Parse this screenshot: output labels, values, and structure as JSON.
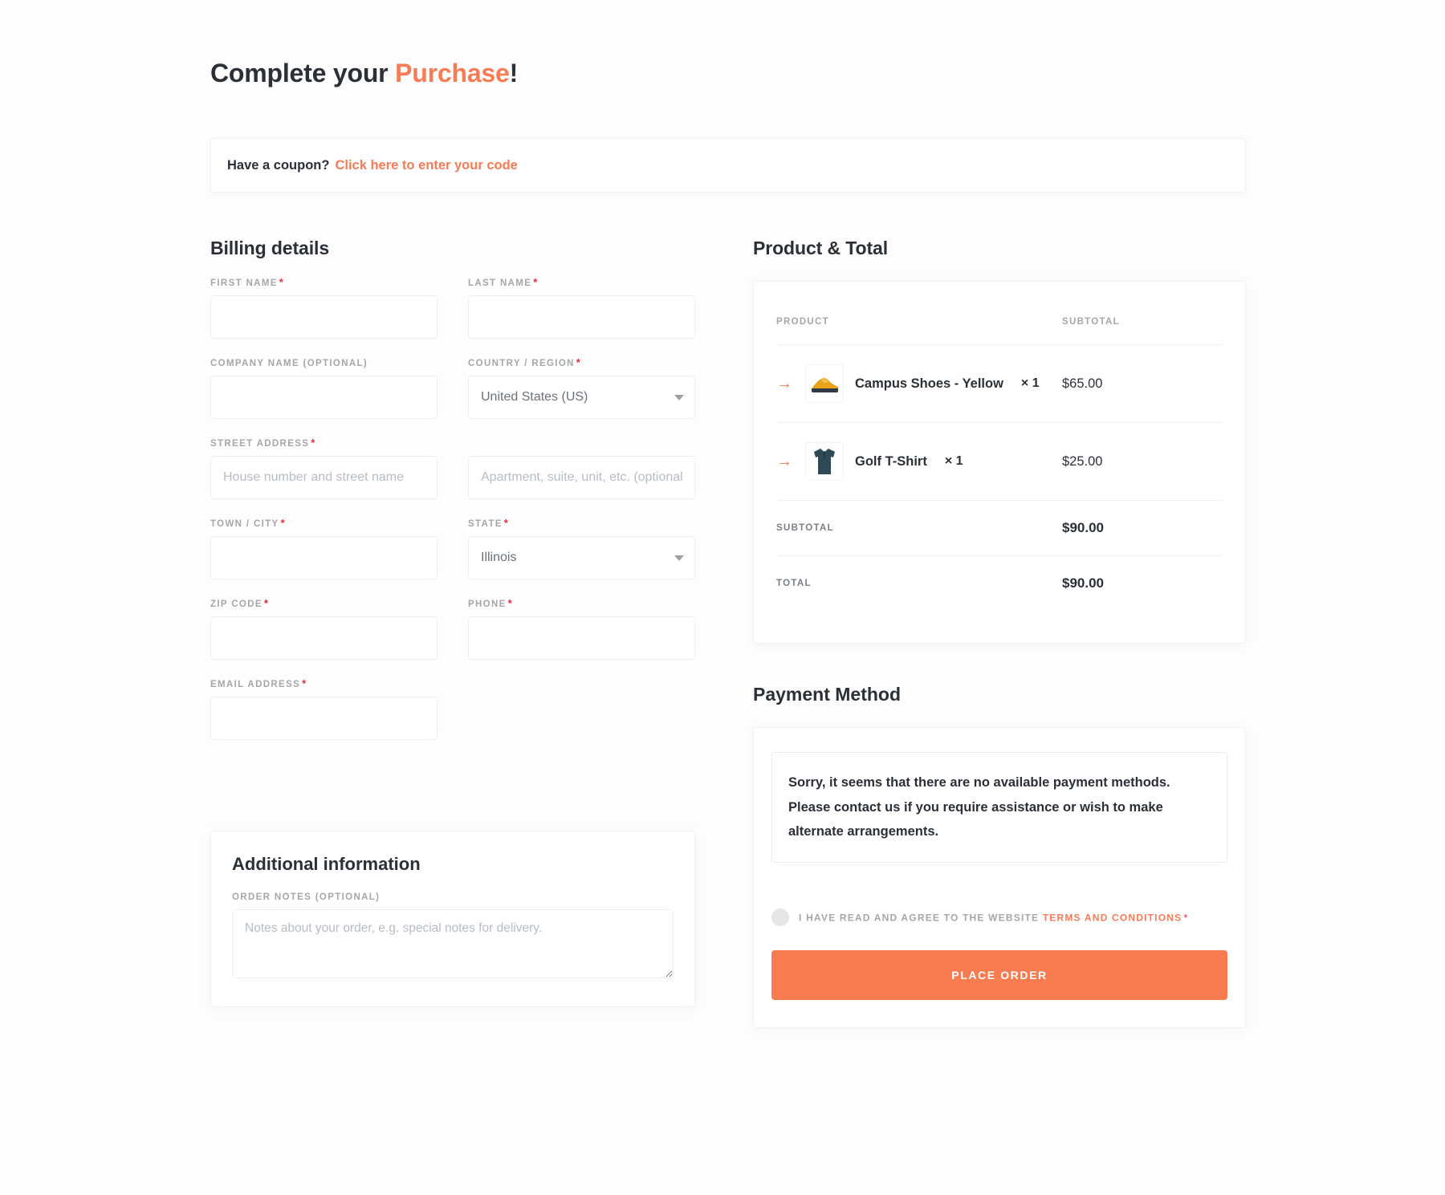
{
  "title": {
    "lead": "Complete your ",
    "accent": "Purchase",
    "trail": "!"
  },
  "coupon": {
    "prompt": "Have a coupon?",
    "link": "Click here to enter your code"
  },
  "billing": {
    "heading": "Billing details",
    "fields": {
      "first_name": {
        "label": "FIRST NAME",
        "value": "",
        "placeholder": ""
      },
      "last_name": {
        "label": "LAST NAME",
        "value": "",
        "placeholder": ""
      },
      "company": {
        "label": "COMPANY NAME (OPTIONAL)",
        "value": "",
        "placeholder": ""
      },
      "country": {
        "label": "COUNTRY / REGION",
        "value": "United States (US)"
      },
      "street": {
        "label": "STREET ADDRESS",
        "value": "",
        "placeholder": "House number and street name"
      },
      "apartment": {
        "label": "",
        "value": "",
        "placeholder": "Apartment, suite, unit, etc. (optional)"
      },
      "city": {
        "label": "TOWN / CITY",
        "value": "",
        "placeholder": ""
      },
      "state": {
        "label": "STATE",
        "value": "Illinois"
      },
      "zip": {
        "label": "ZIP CODE",
        "value": "",
        "placeholder": ""
      },
      "phone": {
        "label": "PHONE",
        "value": "",
        "placeholder": ""
      },
      "email": {
        "label": "EMAIL ADDRESS",
        "value": "",
        "placeholder": ""
      }
    },
    "required_marker": "*"
  },
  "additional": {
    "heading": "Additional information",
    "notes_label": "ORDER NOTES (OPTIONAL)",
    "notes_value": "",
    "notes_placeholder": "Notes about your order, e.g. special notes for delivery."
  },
  "order": {
    "heading": "Product & Total",
    "columns": {
      "product": "PRODUCT",
      "subtotal": "SUBTOTAL"
    },
    "items": [
      {
        "name": "Campus Shoes - Yellow",
        "qty": "× 1",
        "price": "$65.00",
        "thumb": "shoe-icon"
      },
      {
        "name": "Golf T-Shirt",
        "qty": "× 1",
        "price": "$25.00",
        "thumb": "tshirt-icon"
      }
    ],
    "subtotal_label": "SUBTOTAL",
    "subtotal_value": "$90.00",
    "total_label": "TOTAL",
    "total_value": "$90.00"
  },
  "payment": {
    "heading": "Payment Method",
    "notice": "Sorry, it seems that there are no available payment methods. Please contact us if you require assistance or wish to make alternate arrangements.",
    "terms_prefix": "I HAVE READ AND AGREE TO THE WEBSITE ",
    "terms_link": "TERMS AND CONDITIONS",
    "terms_required": "*",
    "place_order_label": "PLACE ORDER"
  },
  "colors": {
    "accent": "#f77b55",
    "button": "#f97b50",
    "required": "#e8293b",
    "text": "#2b2f36",
    "muted": "#a6a6a6"
  }
}
